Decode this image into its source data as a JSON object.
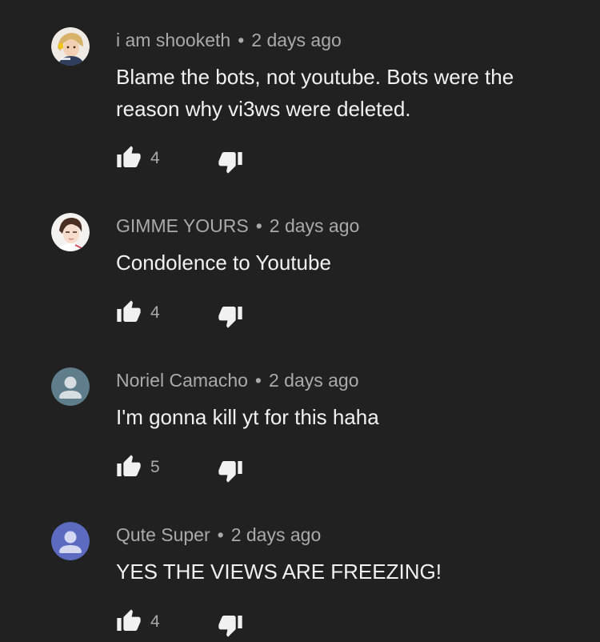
{
  "comments": [
    {
      "author": "i am shooketh",
      "separator": "•",
      "time": "2 days ago",
      "text": "Blame the bots, not youtube. Bots were the reason why vi3ws were deleted.",
      "likes": "4",
      "avatar_icon": "user-photo-avatar"
    },
    {
      "author": "GIMME YOURS",
      "separator": "•",
      "time": "2 days ago",
      "text": "Condolence to Youtube",
      "likes": "4",
      "avatar_icon": "user-photo-avatar"
    },
    {
      "author": "Noriel Camacho",
      "separator": "•",
      "time": "2 days ago",
      "text": "I'm gonna kill yt for this haha",
      "likes": "5",
      "avatar_icon": "default-person-avatar"
    },
    {
      "author": "Qute Super",
      "separator": "•",
      "time": "2 days ago",
      "text": "YES THE VIEWS ARE FREEZING!",
      "likes": "4",
      "avatar_icon": "default-person-avatar"
    }
  ],
  "colors": {
    "background": "#212121",
    "text_primary": "#f1f1f1",
    "text_secondary": "#aaaaaa",
    "icon": "#f1f1f1",
    "default_avatar_grey": "#607d8b",
    "default_avatar_blue": "#5c6bc0"
  }
}
